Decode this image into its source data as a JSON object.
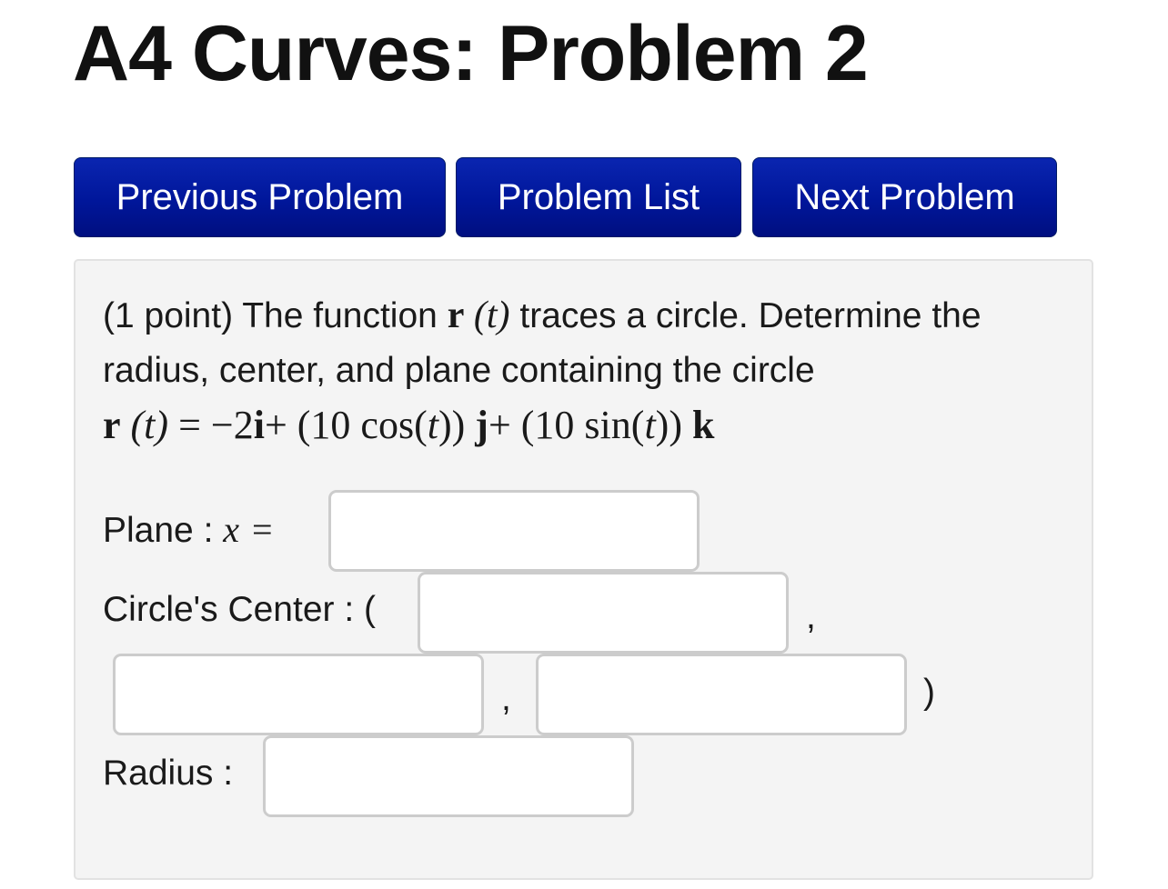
{
  "title": "A4 Curves: Problem 2",
  "nav": {
    "previous_label": "Previous Problem",
    "list_label": "Problem List",
    "next_label": "Next Problem"
  },
  "problem": {
    "points": "(1 point)",
    "text_before_r": "The function",
    "text_after_r": "traces a circle. Determine the radius, center, and plane containing the circle",
    "formula": {
      "lhs_vector": "r",
      "lhs_arg": "(t)",
      "equals": "=",
      "i_coef": "−2",
      "i_unit": "i",
      "plus1": "+",
      "j_coef_open": "(10 cos(",
      "j_coef_t": "t",
      "j_coef_close": "))",
      "j_unit": "j",
      "plus2": "+",
      "k_coef_open": "(10 sin(",
      "k_coef_t": "t",
      "k_coef_close": "))",
      "k_unit": "k"
    },
    "plane_label": "Plane :",
    "plane_var": "x",
    "plane_eq": "=",
    "center_label": "Circle's Center : (",
    "comma": ",",
    "close_paren": ")",
    "radius_label": "Radius :",
    "inputs": {
      "plane": "",
      "center_x": "",
      "center_y": "",
      "center_z": "",
      "radius": ""
    }
  },
  "colors": {
    "button_bg": "#00169a",
    "button_text": "#ffffff",
    "panel_bg": "#f4f4f4",
    "input_border": "#cccccc"
  }
}
